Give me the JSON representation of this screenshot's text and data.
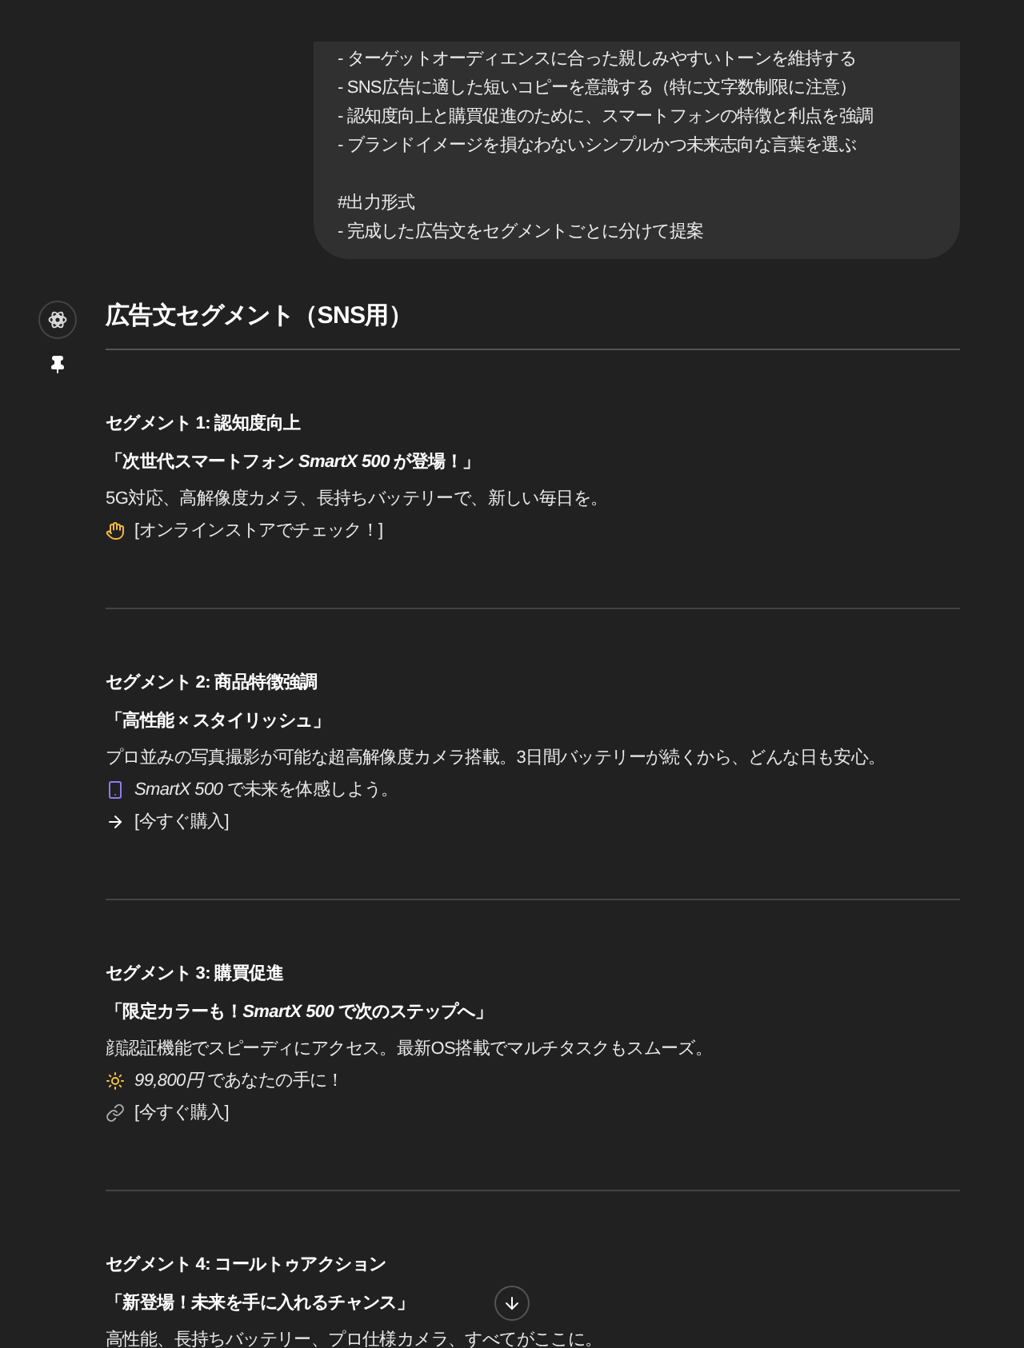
{
  "prompt_bubble": {
    "paragraphs": [
      [
        "- ターゲットオーディエンスに合った親しみやすいトーンを維持する",
        "- SNS広告に適した短いコピーを意識する（特に文字数制限に注意）",
        "- 認知度向上と購買促進のために、スマートフォンの特徴と利点を強調",
        "- ブランドイメージを損なわないシンプルかつ未来志向な言葉を選ぶ"
      ],
      [
        "#出力形式",
        "- 完成した広告文をセグメントごとに分けて提案"
      ]
    ]
  },
  "response": {
    "title": "広告文セグメント（SNS用）",
    "segments": [
      {
        "heading": "セグメント 1: 認知度向上",
        "lines": [
          {
            "kind": "headline",
            "text": "「次世代スマートフォン *SmartX 500* が登場！」"
          },
          {
            "kind": "body",
            "text": "5G対応、高解像度カメラ、長持ちバッテリーで、新しい毎日を。"
          },
          {
            "kind": "point",
            "text": "[オンラインストアでチェック！]"
          }
        ]
      },
      {
        "heading": "セグメント 2: 商品特徴強調",
        "lines": [
          {
            "kind": "headline",
            "text": "「高性能 × スタイリッシュ」"
          },
          {
            "kind": "body",
            "text": "プロ並みの写真撮影が可能な超高解像度カメラ搭載。3日間バッテリーが続くから、どんな日も安心。"
          },
          {
            "kind": "phone",
            "text": "*SmartX 500* で未来を体感しよう。"
          },
          {
            "kind": "arrow",
            "text": "[今すぐ購入]"
          }
        ]
      },
      {
        "heading": "セグメント 3: 購買促進",
        "lines": [
          {
            "kind": "headline",
            "text": "「限定カラーも！*SmartX 500* で次のステップへ」"
          },
          {
            "kind": "body",
            "text": "顔認証機能でスピーディにアクセス。最新OS搭載でマルチタスクもスムーズ。"
          },
          {
            "kind": "sun",
            "text": "*99,800円* であなたの手に！"
          },
          {
            "kind": "link",
            "text": "[今すぐ購入]"
          }
        ]
      },
      {
        "heading": "セグメント 4: コールトゥアクション",
        "lines": [
          {
            "kind": "headline",
            "text": "「新登場！未来を手に入れるチャンス」"
          },
          {
            "kind": "body",
            "text": "高性能、長持ちバッテリー、プロ仕様カメラ、すべてがここに。"
          }
        ]
      }
    ]
  }
}
